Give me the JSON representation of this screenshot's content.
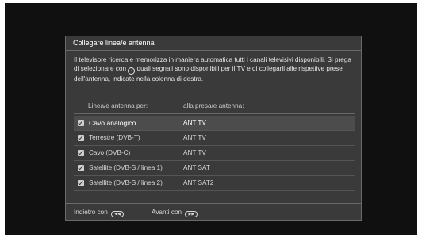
{
  "dialog": {
    "title": "Collegare linea/e antenna",
    "description_part1": "Il televisore ricerca e memorizza in maniera automatica tutti i canali televisivi disponibili. Si prega di selezionare con",
    "description_part2": "quali segnali sono disponibili per il TV e di collegarli alle rispettive prese dell'antenna, indicate nella colonna di destra.",
    "inline_button_icon": "ok-button-icon",
    "column_headers": {
      "left": "Linea/e antenna per:",
      "right": "alla presa/e antenna:"
    },
    "rows": [
      {
        "label": "Cavo analogico",
        "port": "ANT TV",
        "checked": true,
        "selected": true
      },
      {
        "label": "Terrestre (DVB-T)",
        "port": "ANT TV",
        "checked": true,
        "selected": false
      },
      {
        "label": "Cavo (DVB-C)",
        "port": "ANT TV",
        "checked": true,
        "selected": false
      },
      {
        "label": "Satellite (DVB-S / linea 1)",
        "port": "ANT SAT",
        "checked": true,
        "selected": false
      },
      {
        "label": "Satellite (DVB-S / linea 2)",
        "port": "ANT SAT2",
        "checked": true,
        "selected": false
      }
    ],
    "footer": {
      "back_label": "Indietro con",
      "back_icon": "rewind-button-icon",
      "next_label": "Avanti con",
      "next_icon": "forward-button-icon"
    }
  },
  "colors": {
    "background": "#101010",
    "dialog": "#3a3a3a",
    "selected_row": "#4c4c4c",
    "text": "#d8d8d8"
  }
}
